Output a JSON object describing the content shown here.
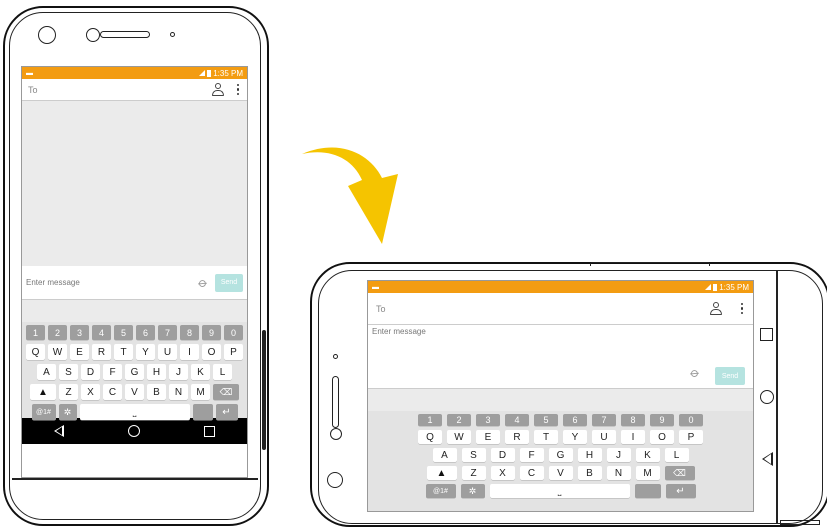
{
  "status": {
    "time": "1:35 PM"
  },
  "compose": {
    "to_label": "To",
    "message_placeholder": "Enter message",
    "send_label": "Send"
  },
  "keyboard": {
    "number_row": [
      "1",
      "2",
      "3",
      "4",
      "5",
      "6",
      "7",
      "8",
      "9",
      "0"
    ],
    "row1": [
      "Q",
      "W",
      "E",
      "R",
      "T",
      "Y",
      "U",
      "I",
      "O",
      "P"
    ],
    "row2": [
      "A",
      "S",
      "D",
      "F",
      "G",
      "H",
      "J",
      "K",
      "L"
    ],
    "row3": [
      "Z",
      "X",
      "C",
      "V",
      "B",
      "N",
      "M"
    ],
    "symbols_label": "@1#",
    "shift_icon": "shift-arrow-icon",
    "settings_icon": "gear-icon",
    "space_icon": "space-bar-icon",
    "backspace_icon": "backspace-icon",
    "enter_icon": "enter-icon"
  },
  "navigation": [
    "back-icon",
    "home-icon",
    "recent-apps-icon"
  ],
  "colors": {
    "status_bar": "#f39c12",
    "send_button": "#b5e3e0",
    "arrow": "#f5c400",
    "keyboard_bg": "#e3e3e3"
  }
}
